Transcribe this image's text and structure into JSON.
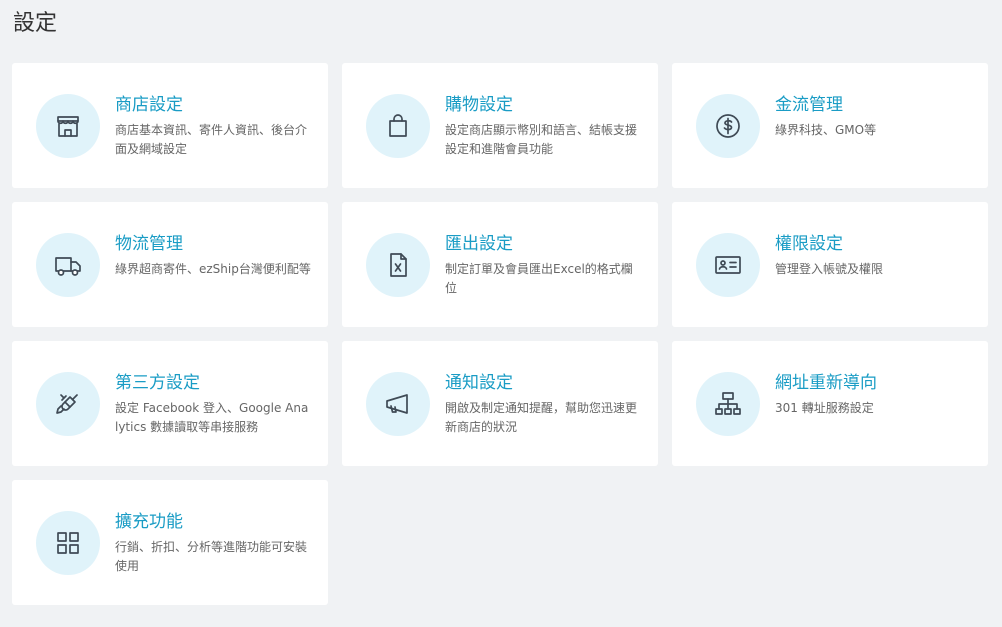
{
  "page": {
    "title": "設定"
  },
  "colors": {
    "background": "#f0f2f4",
    "card": "#ffffff",
    "accent": "#1a9cc5",
    "icon_bg": "#e0f3fa",
    "icon_stroke": "#3f4a55",
    "text_muted": "#666666"
  },
  "cards": [
    {
      "title": "商店設定",
      "description": "商店基本資訊、寄件人資訊、後台介面及網域設定",
      "icon": "store-icon"
    },
    {
      "title": "購物設定",
      "description": "設定商店顯示幣別和語言、結帳支援設定和進階會員功能",
      "icon": "shopping-bag-icon"
    },
    {
      "title": "金流管理",
      "description": "綠界科技、GMO等",
      "icon": "dollar-icon"
    },
    {
      "title": "物流管理",
      "description": "綠界超商寄件、ezShip台灣便利配等",
      "icon": "truck-icon"
    },
    {
      "title": "匯出設定",
      "description": "制定訂單及會員匯出Excel的格式欄位",
      "icon": "excel-file-icon"
    },
    {
      "title": "權限設定",
      "description": "管理登入帳號及權限",
      "icon": "id-card-icon"
    },
    {
      "title": "第三方設定",
      "description": "設定 Facebook 登入、Google Analytics 數據讀取等串接服務",
      "icon": "plug-icon"
    },
    {
      "title": "通知設定",
      "description": "開啟及制定通知提醒，幫助您迅速更新商店的狀況",
      "icon": "megaphone-icon"
    },
    {
      "title": "網址重新導向",
      "description": "301 轉址服務設定",
      "icon": "sitemap-icon"
    },
    {
      "title": "擴充功能",
      "description": "行銷、折扣、分析等進階功能可安裝使用",
      "icon": "grid-icon"
    }
  ]
}
